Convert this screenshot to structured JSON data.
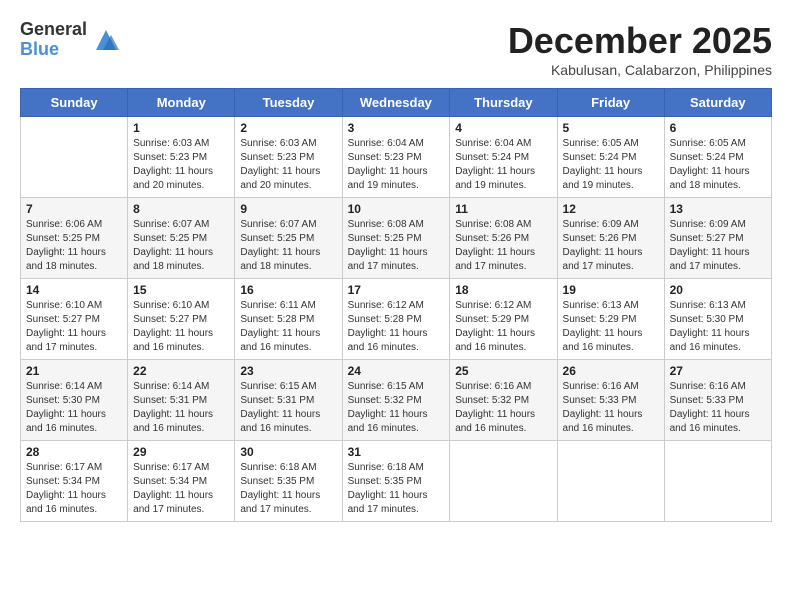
{
  "logo": {
    "general": "General",
    "blue": "Blue"
  },
  "title": "December 2025",
  "location": "Kabulusan, Calabarzon, Philippines",
  "days_header": [
    "Sunday",
    "Monday",
    "Tuesday",
    "Wednesday",
    "Thursday",
    "Friday",
    "Saturday"
  ],
  "weeks": [
    [
      {
        "day": "",
        "sunrise": "",
        "sunset": "",
        "daylight": ""
      },
      {
        "day": "1",
        "sunrise": "Sunrise: 6:03 AM",
        "sunset": "Sunset: 5:23 PM",
        "daylight": "Daylight: 11 hours and 20 minutes."
      },
      {
        "day": "2",
        "sunrise": "Sunrise: 6:03 AM",
        "sunset": "Sunset: 5:23 PM",
        "daylight": "Daylight: 11 hours and 20 minutes."
      },
      {
        "day": "3",
        "sunrise": "Sunrise: 6:04 AM",
        "sunset": "Sunset: 5:23 PM",
        "daylight": "Daylight: 11 hours and 19 minutes."
      },
      {
        "day": "4",
        "sunrise": "Sunrise: 6:04 AM",
        "sunset": "Sunset: 5:24 PM",
        "daylight": "Daylight: 11 hours and 19 minutes."
      },
      {
        "day": "5",
        "sunrise": "Sunrise: 6:05 AM",
        "sunset": "Sunset: 5:24 PM",
        "daylight": "Daylight: 11 hours and 19 minutes."
      },
      {
        "day": "6",
        "sunrise": "Sunrise: 6:05 AM",
        "sunset": "Sunset: 5:24 PM",
        "daylight": "Daylight: 11 hours and 18 minutes."
      }
    ],
    [
      {
        "day": "7",
        "sunrise": "Sunrise: 6:06 AM",
        "sunset": "Sunset: 5:25 PM",
        "daylight": "Daylight: 11 hours and 18 minutes."
      },
      {
        "day": "8",
        "sunrise": "Sunrise: 6:07 AM",
        "sunset": "Sunset: 5:25 PM",
        "daylight": "Daylight: 11 hours and 18 minutes."
      },
      {
        "day": "9",
        "sunrise": "Sunrise: 6:07 AM",
        "sunset": "Sunset: 5:25 PM",
        "daylight": "Daylight: 11 hours and 18 minutes."
      },
      {
        "day": "10",
        "sunrise": "Sunrise: 6:08 AM",
        "sunset": "Sunset: 5:25 PM",
        "daylight": "Daylight: 11 hours and 17 minutes."
      },
      {
        "day": "11",
        "sunrise": "Sunrise: 6:08 AM",
        "sunset": "Sunset: 5:26 PM",
        "daylight": "Daylight: 11 hours and 17 minutes."
      },
      {
        "day": "12",
        "sunrise": "Sunrise: 6:09 AM",
        "sunset": "Sunset: 5:26 PM",
        "daylight": "Daylight: 11 hours and 17 minutes."
      },
      {
        "day": "13",
        "sunrise": "Sunrise: 6:09 AM",
        "sunset": "Sunset: 5:27 PM",
        "daylight": "Daylight: 11 hours and 17 minutes."
      }
    ],
    [
      {
        "day": "14",
        "sunrise": "Sunrise: 6:10 AM",
        "sunset": "Sunset: 5:27 PM",
        "daylight": "Daylight: 11 hours and 17 minutes."
      },
      {
        "day": "15",
        "sunrise": "Sunrise: 6:10 AM",
        "sunset": "Sunset: 5:27 PM",
        "daylight": "Daylight: 11 hours and 16 minutes."
      },
      {
        "day": "16",
        "sunrise": "Sunrise: 6:11 AM",
        "sunset": "Sunset: 5:28 PM",
        "daylight": "Daylight: 11 hours and 16 minutes."
      },
      {
        "day": "17",
        "sunrise": "Sunrise: 6:12 AM",
        "sunset": "Sunset: 5:28 PM",
        "daylight": "Daylight: 11 hours and 16 minutes."
      },
      {
        "day": "18",
        "sunrise": "Sunrise: 6:12 AM",
        "sunset": "Sunset: 5:29 PM",
        "daylight": "Daylight: 11 hours and 16 minutes."
      },
      {
        "day": "19",
        "sunrise": "Sunrise: 6:13 AM",
        "sunset": "Sunset: 5:29 PM",
        "daylight": "Daylight: 11 hours and 16 minutes."
      },
      {
        "day": "20",
        "sunrise": "Sunrise: 6:13 AM",
        "sunset": "Sunset: 5:30 PM",
        "daylight": "Daylight: 11 hours and 16 minutes."
      }
    ],
    [
      {
        "day": "21",
        "sunrise": "Sunrise: 6:14 AM",
        "sunset": "Sunset: 5:30 PM",
        "daylight": "Daylight: 11 hours and 16 minutes."
      },
      {
        "day": "22",
        "sunrise": "Sunrise: 6:14 AM",
        "sunset": "Sunset: 5:31 PM",
        "daylight": "Daylight: 11 hours and 16 minutes."
      },
      {
        "day": "23",
        "sunrise": "Sunrise: 6:15 AM",
        "sunset": "Sunset: 5:31 PM",
        "daylight": "Daylight: 11 hours and 16 minutes."
      },
      {
        "day": "24",
        "sunrise": "Sunrise: 6:15 AM",
        "sunset": "Sunset: 5:32 PM",
        "daylight": "Daylight: 11 hours and 16 minutes."
      },
      {
        "day": "25",
        "sunrise": "Sunrise: 6:16 AM",
        "sunset": "Sunset: 5:32 PM",
        "daylight": "Daylight: 11 hours and 16 minutes."
      },
      {
        "day": "26",
        "sunrise": "Sunrise: 6:16 AM",
        "sunset": "Sunset: 5:33 PM",
        "daylight": "Daylight: 11 hours and 16 minutes."
      },
      {
        "day": "27",
        "sunrise": "Sunrise: 6:16 AM",
        "sunset": "Sunset: 5:33 PM",
        "daylight": "Daylight: 11 hours and 16 minutes."
      }
    ],
    [
      {
        "day": "28",
        "sunrise": "Sunrise: 6:17 AM",
        "sunset": "Sunset: 5:34 PM",
        "daylight": "Daylight: 11 hours and 16 minutes."
      },
      {
        "day": "29",
        "sunrise": "Sunrise: 6:17 AM",
        "sunset": "Sunset: 5:34 PM",
        "daylight": "Daylight: 11 hours and 17 minutes."
      },
      {
        "day": "30",
        "sunrise": "Sunrise: 6:18 AM",
        "sunset": "Sunset: 5:35 PM",
        "daylight": "Daylight: 11 hours and 17 minutes."
      },
      {
        "day": "31",
        "sunrise": "Sunrise: 6:18 AM",
        "sunset": "Sunset: 5:35 PM",
        "daylight": "Daylight: 11 hours and 17 minutes."
      },
      {
        "day": "",
        "sunrise": "",
        "sunset": "",
        "daylight": ""
      },
      {
        "day": "",
        "sunrise": "",
        "sunset": "",
        "daylight": ""
      },
      {
        "day": "",
        "sunrise": "",
        "sunset": "",
        "daylight": ""
      }
    ]
  ]
}
